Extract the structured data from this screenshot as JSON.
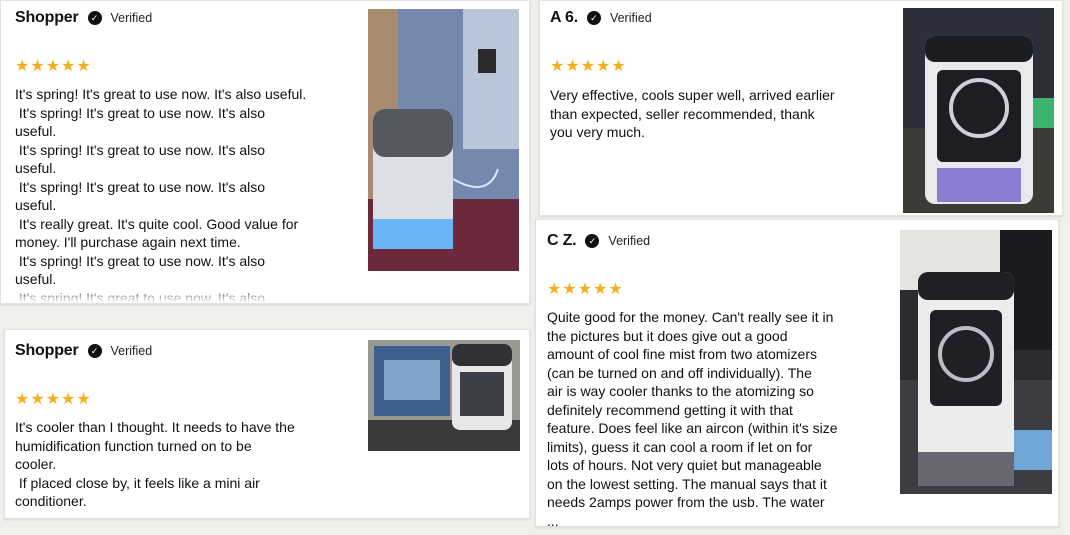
{
  "reviews": [
    {
      "name": "Shopper",
      "verified": "Verified",
      "stars": "★★★★★",
      "text": "It's spring! It's great to use now. It's also useful.\n It's spring! It's great to use now. It's also\nuseful.\n It's spring! It's great to use now. It's also\nuseful.\n It's spring! It's great to use now. It's also\nuseful.\n It's really great. It's quite cool. Good value for\nmoney. I'll purchase again next time.\n It's spring! It's great to use now. It's also\nuseful.\n It's spring! It's great to use now. It's also"
    },
    {
      "name": "Shopper",
      "verified": "Verified",
      "stars": "★★★★★",
      "text": "It's cooler than I thought. It needs to have the\nhumidification function turned on to be\ncooler.\n If placed close by, it feels like a mini air\nconditioner."
    },
    {
      "name": "A 6.",
      "verified": "Verified",
      "stars": "★★★★★",
      "text": "Very effective, cools super well, arrived earlier\nthan expected, seller recommended, thank\nyou very much."
    },
    {
      "name": "C Z.",
      "verified": "Verified",
      "stars": "★★★★★",
      "text": "Quite good for the money. Can't really see it in\nthe pictures but it does give out a good\namount of cool fine mist from two atomizers\n(can be turned on and off individually). The\nair is way cooler thanks to the atomizing so\ndefinitely recommend getting it with that\nfeature. Does feel like an aircon (within it's size\nlimits), guess it can cool a room if let on for\nlots of hours. Not very quiet but manageable\non the lowest setting. The manual says that it\nneeds 2amps power from the usb. The water\n..."
    }
  ],
  "colors": {
    "star": "#f2b01e",
    "background": "#f1efeb",
    "card": "#ffffff"
  },
  "icons": {
    "verified": "check-circle-icon"
  }
}
